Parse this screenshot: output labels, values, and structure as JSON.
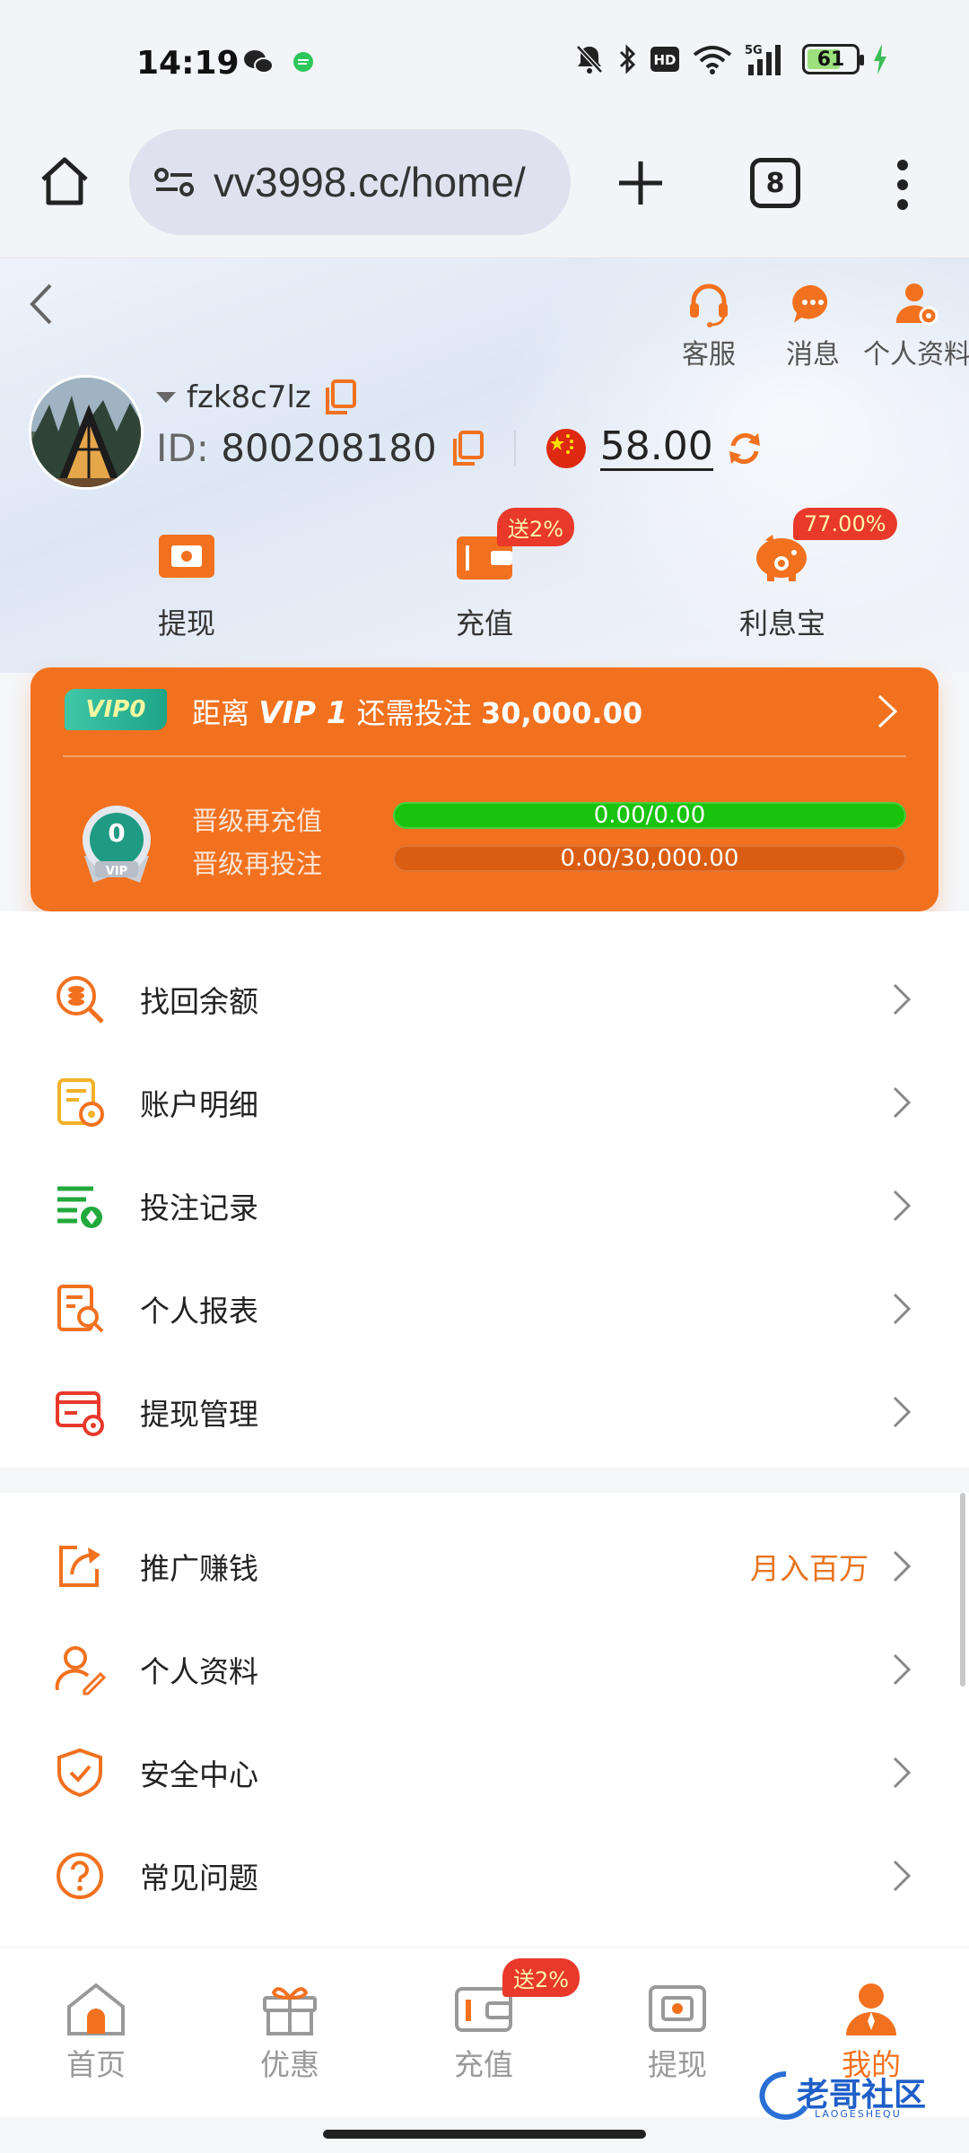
{
  "status_bar": {
    "time": "14:19",
    "battery": "61",
    "network": "5G"
  },
  "browser": {
    "url": "vv3998.cc/home/",
    "tab_count": "8"
  },
  "header": {
    "top_actions": [
      {
        "label": "客服",
        "icon": "headset-icon"
      },
      {
        "label": "消息",
        "icon": "message-icon"
      },
      {
        "label": "个人资料",
        "icon": "profile-settings-icon"
      }
    ],
    "username": "fzk8c7lz",
    "id_label": "ID:",
    "id_value": "800208180",
    "balance": "58.00",
    "quick_actions": [
      {
        "label": "提现",
        "icon": "withdraw-icon"
      },
      {
        "label": "充值",
        "icon": "wallet-icon",
        "badge": "送2%"
      },
      {
        "label": "利息宝",
        "icon": "piggy-bank-icon",
        "badge": "77.00%"
      }
    ]
  },
  "vip": {
    "tag": "VIP0",
    "title_prefix": "距离",
    "next_level": "VIP 1",
    "title_middle": "还需投注",
    "amount": "30,000.00",
    "medal_level": "0",
    "medal_text": "VIP",
    "rows": [
      {
        "label": "晋级再充值",
        "progress": "0.00/0.00",
        "fill_fraction": 1.0
      },
      {
        "label": "晋级再投注",
        "progress": "0.00/30,000.00",
        "fill_fraction": 0.0
      }
    ]
  },
  "menu_section_1": [
    {
      "label": "找回余额",
      "icon": "search-coins-icon"
    },
    {
      "label": "账户明细",
      "icon": "account-detail-icon"
    },
    {
      "label": "投注记录",
      "icon": "bet-record-icon"
    },
    {
      "label": "个人报表",
      "icon": "report-icon"
    },
    {
      "label": "提现管理",
      "icon": "withdraw-manage-icon"
    }
  ],
  "menu_section_2": [
    {
      "label": "推广赚钱",
      "icon": "share-icon",
      "extra": "月入百万"
    },
    {
      "label": "个人资料",
      "icon": "user-edit-icon"
    },
    {
      "label": "安全中心",
      "icon": "shield-icon"
    },
    {
      "label": "常见问题",
      "icon": "question-icon"
    }
  ],
  "bottom_nav": [
    {
      "label": "首页",
      "icon": "home-icon"
    },
    {
      "label": "优惠",
      "icon": "gift-icon"
    },
    {
      "label": "充值",
      "icon": "wallet-icon",
      "badge": "送2%"
    },
    {
      "label": "提现",
      "icon": "withdraw-icon"
    },
    {
      "label": "我的",
      "icon": "user-icon",
      "active": true
    }
  ],
  "colors": {
    "accent": "#f2711f",
    "badge_red": "#e8392b",
    "progress_green": "#19c20d"
  },
  "watermark": "老哥社区",
  "watermark_sub": "LAOGESHEQU"
}
